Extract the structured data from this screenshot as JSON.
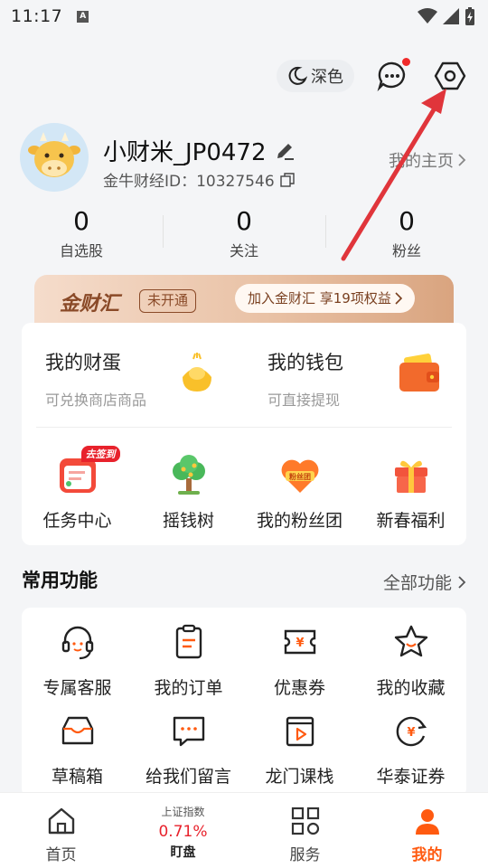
{
  "status_bar": {
    "time": "11:17",
    "app_badge": "A"
  },
  "top_bar": {
    "dark_mode_label": "深色"
  },
  "profile": {
    "username": "小财米_JP0472",
    "id_label": "金牛财经ID：10327546",
    "homepage_link": "我的主页"
  },
  "stats": [
    {
      "value": "0",
      "label": "自选股"
    },
    {
      "value": "0",
      "label": "关注"
    },
    {
      "value": "0",
      "label": "粉丝"
    }
  ],
  "vip": {
    "title": "金财汇",
    "status": "未开通",
    "cta": "加入金财汇 享19项权益"
  },
  "wallet": [
    {
      "title": "我的财蛋",
      "subtitle": "可兑换商店商品",
      "icon": "gold-ingot-icon"
    },
    {
      "title": "我的钱包",
      "subtitle": "可直接提现",
      "icon": "wallet-icon"
    }
  ],
  "activities": [
    {
      "label": "任务中心",
      "badge": "去签到",
      "icon": "task-calendar-icon"
    },
    {
      "label": "摇钱树",
      "icon": "money-tree-icon"
    },
    {
      "label": "我的粉丝团",
      "badge_text": "粉丝团",
      "icon": "fan-club-heart-icon"
    },
    {
      "label": "新春福利",
      "icon": "gift-box-icon"
    }
  ],
  "common_functions": {
    "title": "常用功能",
    "more": "全部功能",
    "items": [
      {
        "label": "专属客服",
        "icon": "headset-icon"
      },
      {
        "label": "我的订单",
        "icon": "order-clipboard-icon"
      },
      {
        "label": "优惠券",
        "icon": "coupon-icon"
      },
      {
        "label": "我的收藏",
        "icon": "star-icon"
      },
      {
        "label": "草稿箱",
        "icon": "drafts-tray-icon"
      },
      {
        "label": "给我们留言",
        "icon": "message-icon"
      },
      {
        "label": "龙门课栈",
        "icon": "course-play-icon"
      },
      {
        "label": "华泰证券",
        "icon": "securities-yuan-icon"
      }
    ]
  },
  "tab_bar": {
    "home": "首页",
    "market_index_label": "上证指数",
    "market_index_value": "0.71%",
    "market_tab": "盯盘",
    "services": "服务",
    "mine": "我的"
  },
  "colors": {
    "accent": "#ff5a10",
    "red": "#e8222c",
    "annotation_arrow": "#e0353b"
  }
}
